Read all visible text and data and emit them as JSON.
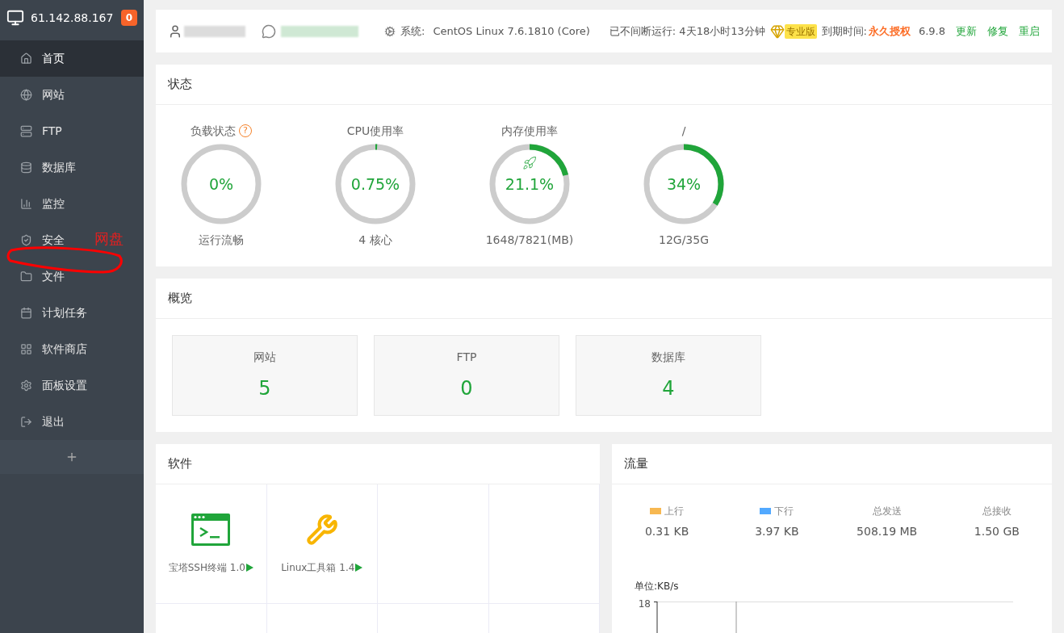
{
  "sidebar": {
    "host": "61.142.88.167",
    "badge": "0",
    "items": [
      {
        "label": "首页",
        "selected": true
      },
      {
        "label": "网站",
        "selected": false
      },
      {
        "label": "FTP",
        "selected": false
      },
      {
        "label": "数据库",
        "selected": false
      },
      {
        "label": "监控",
        "selected": false
      },
      {
        "label": "安全",
        "selected": false
      },
      {
        "label": "文件",
        "selected": false
      },
      {
        "label": "计划任务",
        "selected": false
      },
      {
        "label": "软件商店",
        "selected": false
      },
      {
        "label": "面板设置",
        "selected": false
      },
      {
        "label": "退出",
        "selected": false
      }
    ]
  },
  "annotation": {
    "text": "网盘"
  },
  "header": {
    "system_label": "系统:",
    "system": "CentOS Linux 7.6.1810 (Core)",
    "uptime": "已不间断运行: 4天18小时13分钟",
    "edition": "专业版",
    "expiry_label": "到期时间:",
    "expiry": "永久授权",
    "version": "6.9.8",
    "links": [
      "更新",
      "修复",
      "重启"
    ]
  },
  "status": {
    "title": "状态",
    "gauges": [
      {
        "label": "负载状态",
        "help": "?",
        "value": "0%",
        "level": 0,
        "caption": "运行流畅"
      },
      {
        "label": "CPU使用率",
        "value": "0.75%",
        "level": 0.0075,
        "caption": "4 核心"
      },
      {
        "label": "内存使用率",
        "value": "21.1%",
        "level": 0.211,
        "caption": "1648/7821(MB)",
        "rocket": true
      },
      {
        "label": "/",
        "value": "34%",
        "level": 0.34,
        "caption": "12G/35G"
      }
    ]
  },
  "overview": {
    "title": "概览",
    "cards": [
      {
        "label": "网站",
        "value": "5"
      },
      {
        "label": "FTP",
        "value": "0"
      },
      {
        "label": "数据库",
        "value": "4"
      }
    ]
  },
  "software": {
    "title": "软件",
    "items": [
      {
        "name": "宝塔SSH终端 1.0",
        "kind": "terminal"
      },
      {
        "name": "Linux工具箱 1.4",
        "kind": "tools"
      }
    ]
  },
  "traffic": {
    "title": "流量",
    "stats": [
      {
        "label": "上行",
        "value": "0.31 KB",
        "color": "#f7b851"
      },
      {
        "label": "下行",
        "value": "3.97 KB",
        "color": "#52a9ff"
      },
      {
        "label": "总发送",
        "value": "508.19 MB"
      },
      {
        "label": "总接收",
        "value": "1.50 GB"
      }
    ],
    "unit": "单位:KB/s",
    "top_tick": "18"
  }
}
